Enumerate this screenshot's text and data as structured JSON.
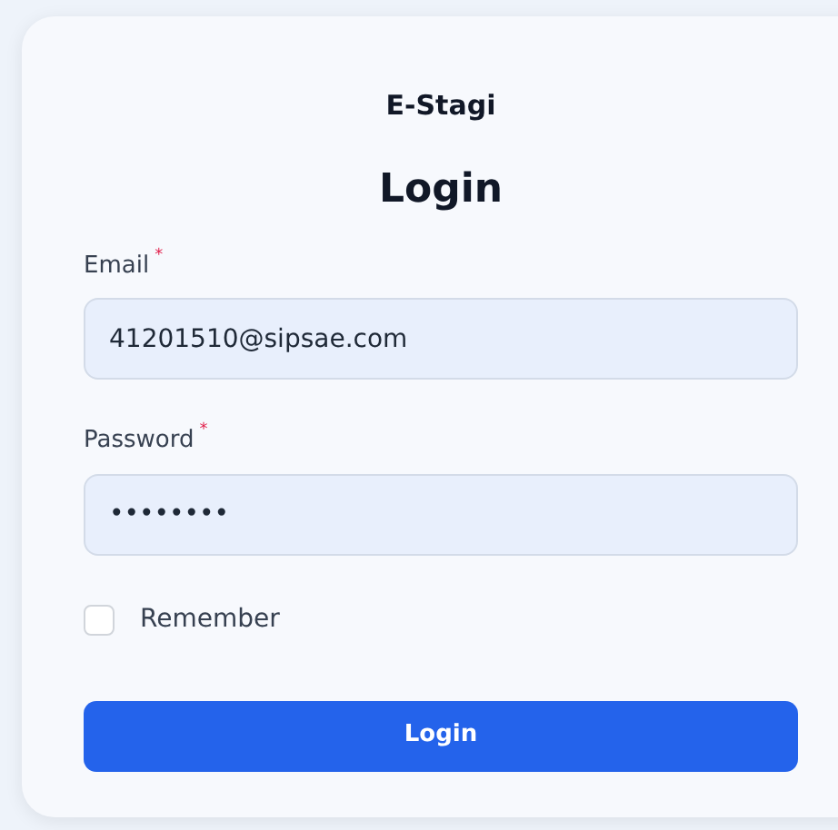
{
  "app_name": "E-Stagi",
  "title": "Login",
  "fields": [
    {
      "label": "Email",
      "required_mark": "*",
      "value": "41201510@sipsae.com"
    },
    {
      "label": "Password",
      "required_mark": "*",
      "value": "••••••••"
    }
  ],
  "remember": {
    "label": "Remember",
    "checked": false
  },
  "submit": {
    "label": "Login"
  }
}
